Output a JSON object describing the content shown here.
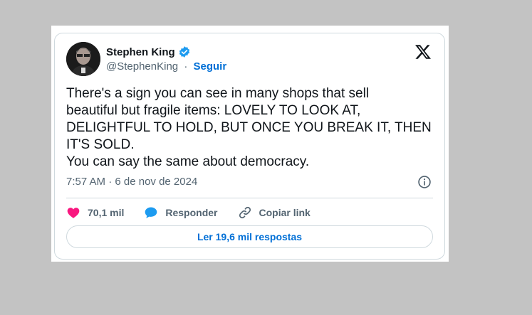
{
  "author": {
    "name": "Stephen King",
    "handle": "@StephenKing",
    "separator": "·",
    "follow_label": "Seguir",
    "verified_icon": "verified-badge-icon"
  },
  "tweet": {
    "lines": [
      "There's a sign you can see in many shops that sell",
      "beautiful but fragile items: LOVELY TO LOOK AT,",
      "DELIGHTFUL TO HOLD, BUT ONCE YOU BREAK IT, THEN",
      "IT'S SOLD.",
      "You can say the same about democracy."
    ],
    "timestamp": "7:57 AM · 6 de nov de 2024"
  },
  "actions": {
    "likes": "70,1 mil",
    "reply_label": "Responder",
    "copy_link_label": "Copiar link"
  },
  "read_replies_label": "Ler 19,6 mil respostas",
  "colors": {
    "accent": "#006fd6",
    "like": "#f91880",
    "reply": "#1d9bf0",
    "verified": "#1d9bf0"
  }
}
